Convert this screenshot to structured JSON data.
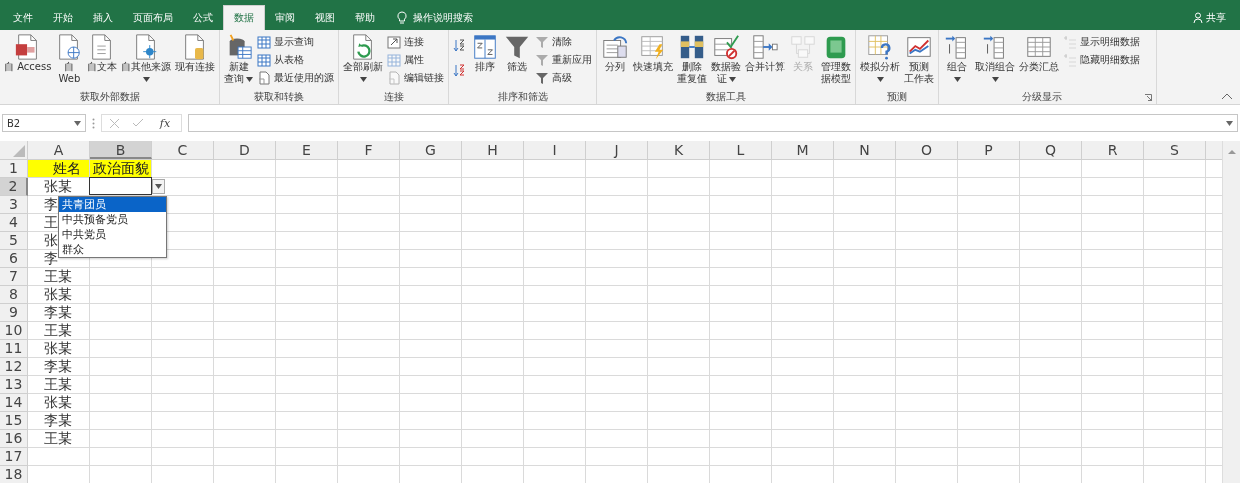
{
  "tabs": [
    {
      "label": "文件",
      "selected": false
    },
    {
      "label": "开始",
      "selected": false
    },
    {
      "label": "插入",
      "selected": false
    },
    {
      "label": "页面布局",
      "selected": false
    },
    {
      "label": "公式",
      "selected": false
    },
    {
      "label": "数据",
      "selected": true
    },
    {
      "label": "审阅",
      "selected": false
    },
    {
      "label": "视图",
      "selected": false
    },
    {
      "label": "帮助",
      "selected": false
    }
  ],
  "tell_me": {
    "label": "操作说明搜索"
  },
  "share": {
    "label": "共享"
  },
  "ribbon": {
    "groups": [
      {
        "label": "获取外部数据",
        "launcher": false,
        "items": [
          {
            "kind": "large",
            "lines": [
              "自 Access"
            ],
            "menu": false,
            "disabled": false
          },
          {
            "kind": "large",
            "lines": [
              "自",
              "Web"
            ],
            "menu": false,
            "disabled": false
          },
          {
            "kind": "large",
            "lines": [
              "自文本"
            ],
            "menu": false,
            "disabled": false
          },
          {
            "kind": "large",
            "lines": [
              "自其他来源"
            ],
            "menu": true,
            "disabled": false
          },
          {
            "kind": "large",
            "lines": [
              "现有连接"
            ],
            "menu": false,
            "disabled": false
          }
        ]
      },
      {
        "label": "获取和转换",
        "launcher": false,
        "items": [
          {
            "kind": "large",
            "lines": [
              "新建",
              "查询"
            ],
            "menu": true,
            "disabled": false
          },
          {
            "kind": "stack",
            "items": [
              {
                "label": "显示查询",
                "disabled": false
              },
              {
                "label": "从表格",
                "disabled": false
              },
              {
                "label": "最近使用的源",
                "disabled": false
              }
            ]
          }
        ]
      },
      {
        "label": "连接",
        "launcher": false,
        "items": [
          {
            "kind": "large",
            "lines": [
              "全部刷新"
            ],
            "menu": true,
            "disabled": false
          },
          {
            "kind": "stack",
            "items": [
              {
                "label": "连接",
                "disabled": false
              },
              {
                "label": "属性",
                "disabled": true
              },
              {
                "label": "编辑链接",
                "disabled": true
              }
            ]
          }
        ]
      },
      {
        "label": "排序和筛选",
        "launcher": false,
        "items": [
          {
            "kind": "stack",
            "items": [
              {
                "disabled": false
              },
              {
                "disabled": false
              }
            ]
          },
          {
            "kind": "large",
            "lines": [
              "排序"
            ],
            "menu": false,
            "disabled": false
          },
          {
            "kind": "large",
            "lines": [
              "筛选"
            ],
            "menu": false,
            "disabled": false
          },
          {
            "kind": "stack",
            "items": [
              {
                "label": "清除",
                "disabled": true
              },
              {
                "label": "重新应用",
                "disabled": true
              },
              {
                "label": "高级",
                "disabled": false
              }
            ]
          }
        ]
      },
      {
        "label": "数据工具",
        "launcher": false,
        "items": [
          {
            "kind": "large",
            "lines": [
              "分列"
            ],
            "menu": false,
            "disabled": false
          },
          {
            "kind": "large",
            "lines": [
              "快速填充"
            ],
            "menu": false,
            "disabled": false
          },
          {
            "kind": "large",
            "lines": [
              "删除",
              "重复值"
            ],
            "menu": false,
            "disabled": false
          },
          {
            "kind": "large",
            "lines": [
              "数据验",
              "证"
            ],
            "menu": true,
            "disabled": false
          },
          {
            "kind": "large",
            "lines": [
              "合并计算"
            ],
            "menu": false,
            "disabled": false
          },
          {
            "kind": "large",
            "lines": [
              "关系"
            ],
            "menu": false,
            "disabled": true
          },
          {
            "kind": "large",
            "lines": [
              "管理数",
              "据模型"
            ],
            "menu": false,
            "disabled": false
          }
        ]
      },
      {
        "label": "预测",
        "launcher": false,
        "items": [
          {
            "kind": "large",
            "lines": [
              "模拟分析"
            ],
            "menu": true,
            "disabled": false
          },
          {
            "kind": "large",
            "lines": [
              "预测",
              "工作表"
            ],
            "menu": false,
            "disabled": false
          }
        ]
      },
      {
        "label": "分级显示",
        "launcher": true,
        "items": [
          {
            "kind": "large",
            "lines": [
              "组合"
            ],
            "menu": true,
            "disabled": false
          },
          {
            "kind": "large",
            "lines": [
              "取消组合"
            ],
            "menu": true,
            "disabled": false
          },
          {
            "kind": "large",
            "lines": [
              "分类汇总"
            ],
            "menu": false,
            "disabled": false
          },
          {
            "kind": "stack",
            "items": [
              {
                "label": "显示明细数据",
                "disabled": true
              },
              {
                "label": "隐藏明细数据",
                "disabled": true
              }
            ]
          }
        ]
      }
    ]
  },
  "name_box": {
    "value": "B2"
  },
  "formula_bar": {
    "function_label": "fx"
  },
  "sheet": {
    "columns": [
      {
        "label": "A",
        "selected": false
      },
      {
        "label": "B",
        "selected": true
      },
      {
        "label": "C",
        "selected": false
      },
      {
        "label": "D",
        "selected": false
      },
      {
        "label": "E",
        "selected": false
      },
      {
        "label": "F",
        "selected": false
      },
      {
        "label": "G",
        "selected": false
      },
      {
        "label": "H",
        "selected": false
      },
      {
        "label": "I",
        "selected": false
      },
      {
        "label": "J",
        "selected": false
      },
      {
        "label": "K",
        "selected": false
      },
      {
        "label": "L",
        "selected": false
      },
      {
        "label": "M",
        "selected": false
      },
      {
        "label": "N",
        "selected": false
      },
      {
        "label": "O",
        "selected": false
      },
      {
        "label": "P",
        "selected": false
      },
      {
        "label": "Q",
        "selected": false
      },
      {
        "label": "R",
        "selected": false
      },
      {
        "label": "S",
        "selected": false
      }
    ],
    "rows": [
      {
        "number": "1",
        "selected": false,
        "highlighted": true,
        "cells": [
          "姓名",
          "政治面貌"
        ]
      },
      {
        "number": "2",
        "selected": true,
        "highlighted": false,
        "cells": [
          "张某"
        ]
      },
      {
        "number": "3",
        "selected": false,
        "highlighted": false,
        "cells": [
          "李"
        ]
      },
      {
        "number": "4",
        "selected": false,
        "highlighted": false,
        "cells": [
          "王"
        ]
      },
      {
        "number": "5",
        "selected": false,
        "highlighted": false,
        "cells": [
          "张"
        ]
      },
      {
        "number": "6",
        "selected": false,
        "highlighted": false,
        "cells": [
          "李"
        ]
      },
      {
        "number": "7",
        "selected": false,
        "highlighted": false,
        "cells": [
          "王某"
        ]
      },
      {
        "number": "8",
        "selected": false,
        "highlighted": false,
        "cells": [
          "张某"
        ]
      },
      {
        "number": "9",
        "selected": false,
        "highlighted": false,
        "cells": [
          "李某"
        ]
      },
      {
        "number": "10",
        "selected": false,
        "highlighted": false,
        "cells": [
          "王某"
        ]
      },
      {
        "number": "11",
        "selected": false,
        "highlighted": false,
        "cells": [
          "张某"
        ]
      },
      {
        "number": "12",
        "selected": false,
        "highlighted": false,
        "cells": [
          "李某"
        ]
      },
      {
        "number": "13",
        "selected": false,
        "highlighted": false,
        "cells": [
          "王某"
        ]
      },
      {
        "number": "14",
        "selected": false,
        "highlighted": false,
        "cells": [
          "张某"
        ]
      },
      {
        "number": "15",
        "selected": false,
        "highlighted": false,
        "cells": [
          "李某"
        ]
      },
      {
        "number": "16",
        "selected": false,
        "highlighted": false,
        "cells": [
          "王某"
        ]
      },
      {
        "number": "17",
        "selected": false,
        "highlighted": false
      },
      {
        "number": "18",
        "selected": false,
        "highlighted": false
      }
    ]
  },
  "validation_list": {
    "options": [
      {
        "label": "共青团员",
        "selected": true
      },
      {
        "label": "中共预备党员",
        "selected": false
      },
      {
        "label": "中共党员",
        "selected": false
      },
      {
        "label": "群众",
        "selected": false
      }
    ]
  }
}
